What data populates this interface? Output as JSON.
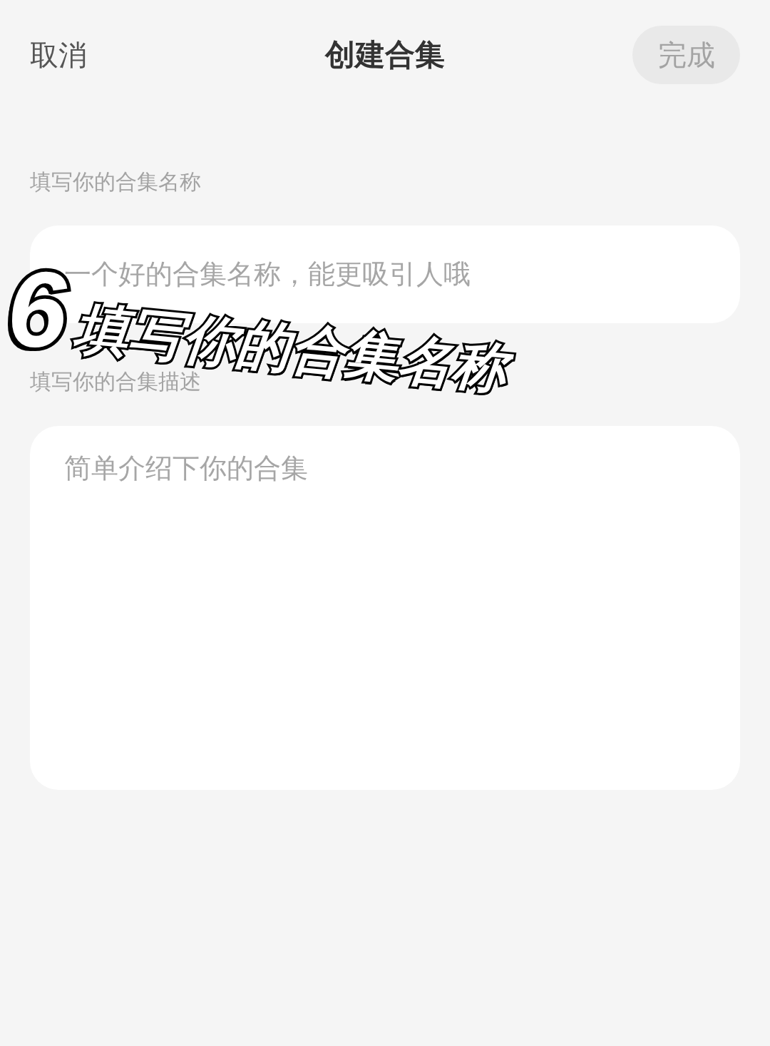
{
  "header": {
    "cancel": "取消",
    "title": "创建合集",
    "done": {
      "label": "完成",
      "disabled": true
    }
  },
  "fields": [
    {
      "kind": "input",
      "label": "填写你的合集名称",
      "placeholder": "一个好的合集名称，能更吸引人哦"
    },
    {
      "kind": "textarea",
      "label": "填写你的合集描述",
      "placeholder": "简单介绍下你的合集"
    }
  ],
  "step_caption": {
    "number": "6",
    "text": "填写你的合集名称"
  }
}
